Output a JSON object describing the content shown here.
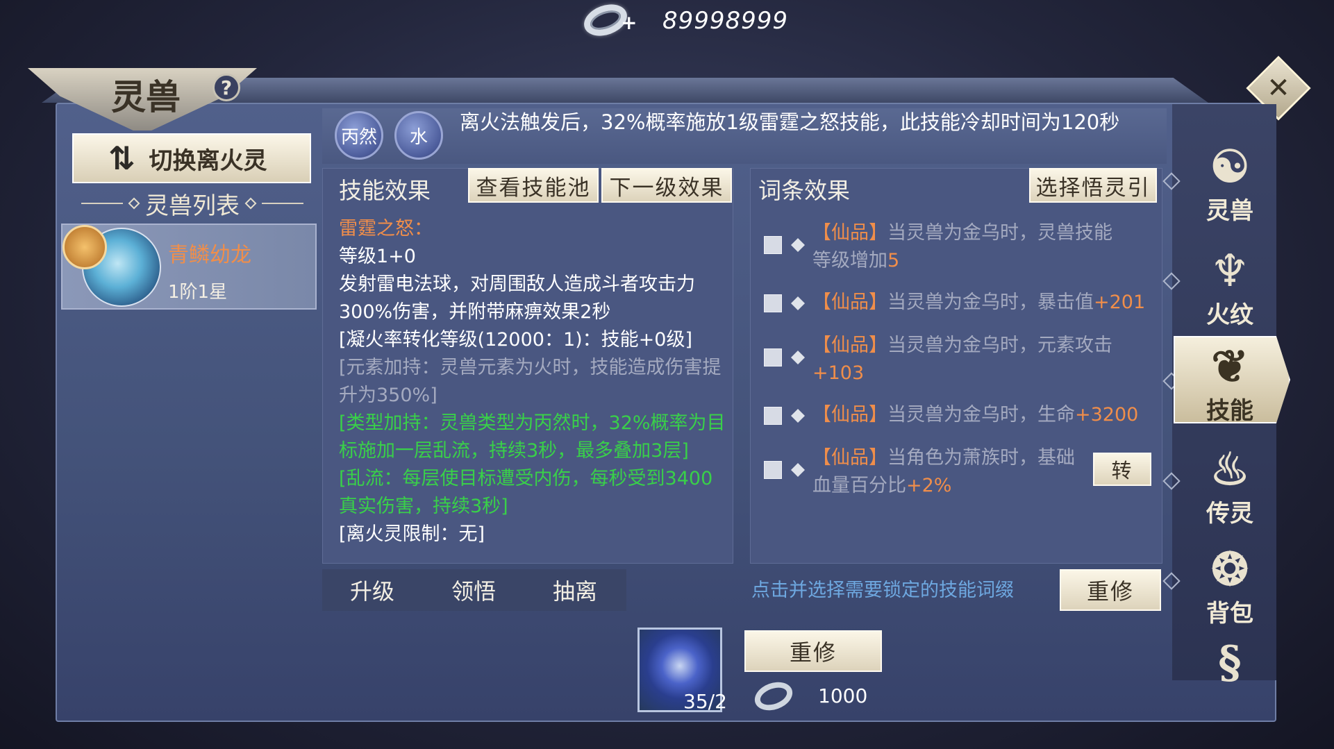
{
  "currency": {
    "icon": "silver-ring-icon",
    "amount": "89998999"
  },
  "window": {
    "title": "灵兽",
    "help_label": "?",
    "close_label": "✕"
  },
  "left": {
    "switch_button": "切换离火灵",
    "list_header": "灵兽列表",
    "pets": [
      {
        "name": "青鳞幼龙",
        "rank": "1阶1星"
      }
    ]
  },
  "description": {
    "elements": [
      "丙然",
      "水"
    ],
    "text": "离火法触发后，32%概率施放1级雷霆之怒技能，此技能冷却时间为120秒"
  },
  "skill_panel": {
    "title": "技能效果",
    "view_pool_button": "查看技能池",
    "next_level_button": "下一级效果",
    "lines": [
      {
        "text": "雷霆之怒：",
        "style": "name"
      },
      {
        "text": "等级1+0",
        "style": "white"
      },
      {
        "text": "发射雷电法球，对周围敌人造成斗者攻击力300%伤害，并附带麻痹效果2秒",
        "style": "white"
      },
      {
        "text": "[凝火率转化等级(12000：1)：技能+0级]",
        "style": "white"
      },
      {
        "text": "[元素加持：灵兽元素为火时，技能造成伤害提升为350%]",
        "style": "gray"
      },
      {
        "text": "[类型加持：灵兽类型为丙然时，32%概率为目标施加一层乱流，持续3秒，最多叠加3层]",
        "style": "green"
      },
      {
        "text": "[乱流：每层使目标遭受内伤，每秒受到3400真实伤害，持续3秒]",
        "style": "green"
      },
      {
        "text": "[离火灵限制：无]",
        "style": "white"
      }
    ]
  },
  "affix_panel": {
    "title": "词条效果",
    "choose_button": "选择悟灵引",
    "affixes": [
      {
        "tag": "【仙品】",
        "text": "当灵兽为金乌时，灵兽技能等级增加",
        "value": "5"
      },
      {
        "tag": "【仙品】",
        "text": "当灵兽为金乌时，暴击值",
        "value": "+201"
      },
      {
        "tag": "【仙品】",
        "text": "当灵兽为金乌时，元素攻击",
        "value": "+103"
      },
      {
        "tag": "【仙品】",
        "text": "当灵兽为金乌时，生命",
        "value": "+3200"
      },
      {
        "tag": "【仙品】",
        "text": "当角色为萧族时，基础血量百分比",
        "value": "+2%"
      }
    ],
    "transfer_button": "转"
  },
  "bottom": {
    "tabs": [
      "升级",
      "领悟",
      "抽离"
    ],
    "lock_hint": "点击并选择需要锁定的技能词缀",
    "reforge_button": "重修",
    "cost_item_count": "35/2",
    "reforge_button_2": "重修",
    "coin_cost": "1000"
  },
  "nav": [
    {
      "label": "灵兽",
      "icon": "yin-yang-icon"
    },
    {
      "label": "火纹",
      "icon": "flame-crest-icon"
    },
    {
      "label": "技能",
      "icon": "skill-book-icon",
      "active": true
    },
    {
      "label": "传灵",
      "icon": "flame-book-icon"
    },
    {
      "label": "背包",
      "icon": "pouch-icon"
    },
    {
      "label": "",
      "icon": "dragon-icon"
    }
  ],
  "colors": {
    "accent_orange": "#f08e4a",
    "green_text": "#39d049",
    "hint_blue": "#6ea8e0",
    "panel_blue": "#4a5781"
  }
}
